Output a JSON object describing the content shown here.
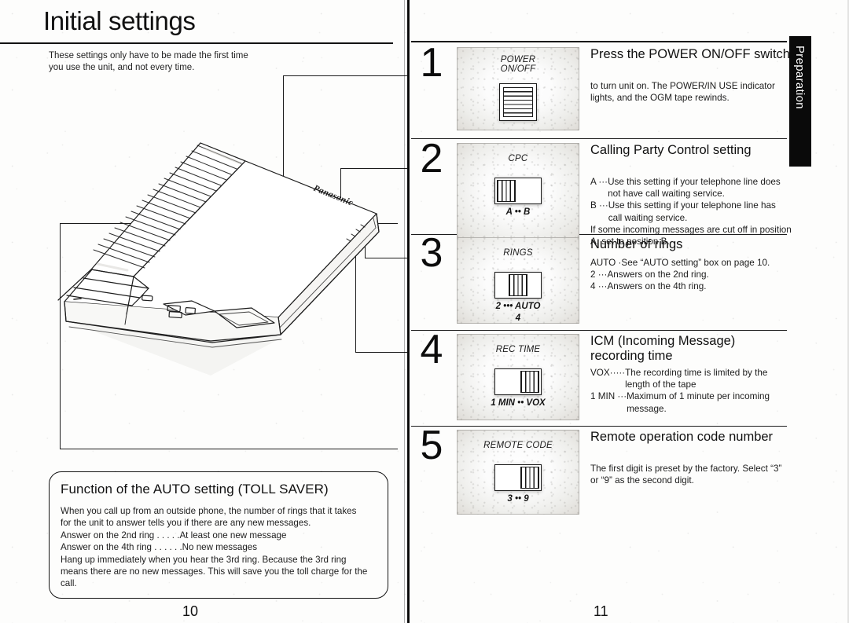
{
  "document": {
    "title": "Initial settings",
    "intro": "These settings only have to be made the first time\nyou use the unit, and not every time.",
    "left_page_number": "10",
    "right_page_number": "11",
    "side_tab": "Preparation",
    "brand_logo": "Panasonic"
  },
  "auto_box": {
    "title": "Function of the AUTO setting (TOLL SAVER)",
    "lines": [
      "When you call up from an outside phone, the number of rings that it takes",
      "for the unit to answer tells you if there are any new messages.",
      "Answer on the 2nd ring . . . . .At least one new message",
      "Answer on the 4th ring . . . . . .No new messages",
      "Hang up immediately when you hear the 3rd ring. Because the 3rd ring",
      "means there are no new messages. This will save you the toll charge for the",
      "call."
    ]
  },
  "steps": [
    {
      "number": "1",
      "panel_label": "POWER\nON/OFF",
      "switch_type": "rocker",
      "knob_position": "",
      "positions": "",
      "positions_sub": "",
      "heading": "Press the POWER ON/OFF switch",
      "body": [
        {
          "key": "",
          "val": "to turn unit on. The POWER/IN USE indicator lights, and the OGM tape rewinds."
        }
      ]
    },
    {
      "number": "2",
      "panel_label": "CPC",
      "switch_type": "slider",
      "knob_position": "left",
      "positions": "A  ••  B",
      "positions_sub": "",
      "heading": "Calling Party Control setting",
      "body": [
        {
          "key": "A ···",
          "val": "Use this setting if your telephone line does not have call waiting service."
        },
        {
          "key": "B ···",
          "val": "Use this setting if your telephone line has call waiting service."
        },
        {
          "key": "",
          "val": "If some incoming messages are cut off in position A, set to position B."
        }
      ]
    },
    {
      "number": "3",
      "panel_label": "RINGS",
      "switch_type": "slider",
      "knob_position": "mid",
      "positions": "2  •••  AUTO",
      "positions_sub": "4",
      "heading": "Number of rings",
      "body": [
        {
          "key": "AUTO ·",
          "val": "See “AUTO setting” box on page 10."
        },
        {
          "key": "2 ···",
          "val": "Answers on the 2nd ring."
        },
        {
          "key": "4 ···",
          "val": "Answers on the 4th ring."
        }
      ]
    },
    {
      "number": "4",
      "panel_label": "REC TIME",
      "switch_type": "slider",
      "knob_position": "right",
      "positions": "1 MIN  ••  VOX",
      "positions_sub": "",
      "heading": "ICM (Incoming Message) recording time",
      "body": [
        {
          "key": "VOX·····",
          "val": "The recording time is limited by the length of the tape"
        },
        {
          "key": "1 MIN ···",
          "val": "Maximum of 1 minute per incoming message."
        }
      ]
    },
    {
      "number": "5",
      "panel_label": "REMOTE CODE",
      "switch_type": "slider",
      "knob_position": "right",
      "positions": "3  ••  9",
      "positions_sub": "",
      "heading": "Remote operation code number",
      "body": [
        {
          "key": "",
          "val": "The first digit is preset by the factory. Select “3” or “9” as the second digit."
        }
      ]
    }
  ]
}
